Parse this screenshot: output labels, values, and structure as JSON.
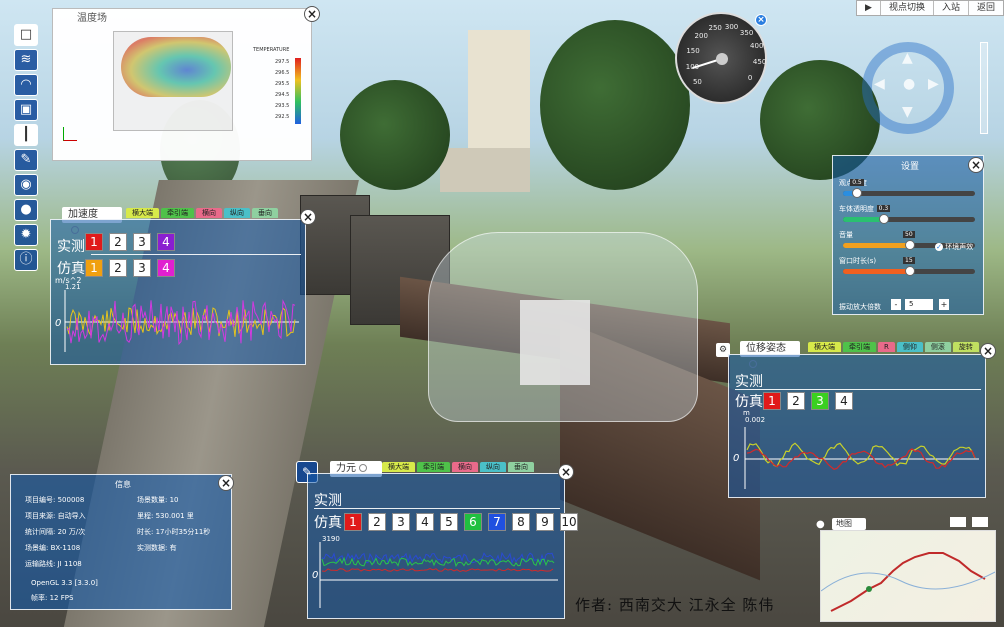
{
  "sidebar": {
    "icons": [
      "square-icon",
      "flow-icon",
      "speedometer-icon",
      "train-icon",
      "thermometer-icon",
      "pencil-icon",
      "dial-icon",
      "location-pin-icon",
      "gear-icon",
      "info-icon"
    ]
  },
  "topnav": {
    "play": "▶",
    "viewpoint": "视点切换",
    "station": "入站",
    "back": "返回"
  },
  "gauge": {
    "labels": [
      "50",
      "100",
      "150",
      "200",
      "250",
      "300",
      "350",
      "400",
      "450",
      "0"
    ],
    "needle_value": 40
  },
  "temperature": {
    "title": "温度场",
    "legend_title": "TEMPERATURE",
    "ticks": [
      "297.5",
      "296.5",
      "295.5",
      "294.5",
      "293.5",
      "292.5"
    ]
  },
  "accel": {
    "title": "加速度",
    "tabs": [
      "横大端",
      "牵引端",
      "横向",
      "纵向",
      "垂向"
    ],
    "measured_label": "实测",
    "sim_label": "仿真",
    "measured_boxes": [
      "1",
      "2",
      "3",
      "4"
    ],
    "sim_boxes": [
      "1",
      "2",
      "3",
      "4"
    ],
    "unit": "m/s^2",
    "ymax": "1.21",
    "zero": "0"
  },
  "settings": {
    "title": "设置",
    "sliders": [
      {
        "label": "观点高度",
        "value": "0.5",
        "level": 0.1
      },
      {
        "label": "车体透明度",
        "value": "0.3",
        "level": 0.3
      },
      {
        "label": "音量",
        "value": "50",
        "level": 0.5
      },
      {
        "label": "窗口时长(s)",
        "value": "15",
        "level": 0.5
      }
    ],
    "sound_toggle": "环境声效",
    "vib_label": "振动放大倍数",
    "vib_value": "5",
    "minus": "-",
    "plus": "+"
  },
  "displacement": {
    "title": "位移姿态",
    "tabs": [
      "横大端",
      "牵引端",
      "R",
      "侧仰",
      "侧滚",
      "旋转"
    ],
    "measured_label": "实测",
    "sim_label": "仿真",
    "sim_boxes": [
      "1",
      "2",
      "3",
      "4"
    ],
    "unit": "m",
    "ymax": "0.002",
    "zero": "0"
  },
  "force": {
    "title": "力元",
    "tabs": [
      "横大端",
      "牵引端",
      "横向",
      "纵向",
      "垂向"
    ],
    "measured_label": "实测",
    "sim_label": "仿真",
    "sim_boxes": [
      "1",
      "2",
      "3",
      "4",
      "5",
      "6",
      "7",
      "8",
      "9",
      "10"
    ],
    "ymax": "3190",
    "zero": "0"
  },
  "info": {
    "title": "信息",
    "left": [
      {
        "k": "项目编号:",
        "v": "500008"
      },
      {
        "k": "项目来源:",
        "v": "自动导入"
      },
      {
        "k": "统计间隔:",
        "v": "20 万/次"
      },
      {
        "k": "场景编:",
        "v": "BX-1108"
      },
      {
        "k": "运输路线:",
        "v": "JI 1108"
      }
    ],
    "right": [
      {
        "k": "场景数量:",
        "v": "10"
      },
      {
        "k": "里程:",
        "v": "530.001 里"
      },
      {
        "k": "时长:",
        "v": "17小时35分11秒"
      },
      {
        "k": "实测数据:",
        "v": "有"
      }
    ],
    "gl": "OpenGL 3.3 [3.3.0]",
    "fps": "帧率: 12 FPS"
  },
  "map": {
    "title": "地图"
  },
  "author": "作者:  西南交大  江永全  陈伟"
}
